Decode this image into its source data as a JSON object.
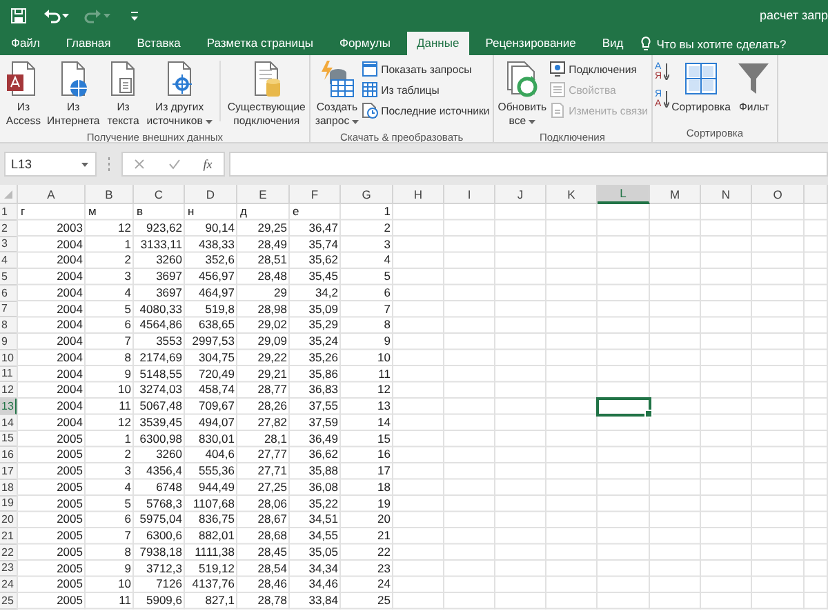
{
  "window": {
    "title": "расчет запр"
  },
  "quick_access": [
    {
      "kind": "save",
      "disabled": false
    },
    {
      "kind": "undo",
      "disabled": false
    },
    {
      "kind": "redo",
      "disabled": true
    },
    {
      "kind": "customize",
      "disabled": false
    }
  ],
  "tabs": [
    {
      "label": "Файл",
      "selected": false
    },
    {
      "label": "Главная",
      "selected": false
    },
    {
      "label": "Вставка",
      "selected": false
    },
    {
      "label": "Разметка страницы",
      "selected": false
    },
    {
      "label": "Формулы",
      "selected": false
    },
    {
      "label": "Данные",
      "selected": true
    },
    {
      "label": "Рецензирование",
      "selected": false
    },
    {
      "label": "Вид",
      "selected": false
    }
  ],
  "tell_me": {
    "text": "Что вы хотите сделать?"
  },
  "ribbon": {
    "groups": [
      {
        "label": "Получение внешних данных",
        "items": [
          {
            "kind": "large",
            "lines": [
              "Из",
              "Access"
            ]
          },
          {
            "kind": "large",
            "lines": [
              "Из",
              "Интернета"
            ]
          },
          {
            "kind": "large",
            "lines": [
              "Из",
              "текста"
            ]
          },
          {
            "kind": "large",
            "lines": [
              "Из других",
              "источников"
            ],
            "dropdown": true
          },
          {
            "kind": "separator"
          },
          {
            "kind": "large",
            "lines": [
              "Существующие",
              "подключения"
            ]
          }
        ]
      },
      {
        "label": "Скачать & преобразовать",
        "items": [
          {
            "kind": "large",
            "lines": [
              "Создать",
              "запрос"
            ],
            "dropdown": true
          },
          {
            "kind": "stack",
            "entries": [
              {
                "label": "Показать запросы",
                "disabled": false
              },
              {
                "label": "Из таблицы",
                "disabled": false
              },
              {
                "label": "Последние источники",
                "disabled": false
              }
            ]
          }
        ]
      },
      {
        "label": "Подключения",
        "items": [
          {
            "kind": "large",
            "lines": [
              "Обновить",
              "все"
            ],
            "dropdown": true
          },
          {
            "kind": "stack",
            "entries": [
              {
                "label": "Подключения",
                "disabled": false
              },
              {
                "label": "Свойства",
                "disabled": true
              },
              {
                "label": "Изменить связи",
                "disabled": true
              }
            ]
          }
        ]
      },
      {
        "label": "Сортировка",
        "items": [
          {
            "kind": "sort-stack",
            "entries": [
              {
                "top": "А",
                "bottom": "Я"
              },
              {
                "top": "Я",
                "bottom": "А"
              }
            ]
          },
          {
            "kind": "large",
            "lines": [
              "Сортировка"
            ]
          },
          {
            "kind": "large",
            "lines": [
              "Фильт"
            ]
          }
        ]
      }
    ]
  },
  "name_box": {
    "value": "L13"
  },
  "formula_bar": {
    "function_label": "fx"
  },
  "columns": [
    {
      "label": "A",
      "selected": false
    },
    {
      "label": "B",
      "selected": false
    },
    {
      "label": "C",
      "selected": false
    },
    {
      "label": "D",
      "selected": false
    },
    {
      "label": "E",
      "selected": false
    },
    {
      "label": "F",
      "selected": false
    },
    {
      "label": "G",
      "selected": false
    },
    {
      "label": "H",
      "selected": false
    },
    {
      "label": "I",
      "selected": false
    },
    {
      "label": "J",
      "selected": false
    },
    {
      "label": "K",
      "selected": false
    },
    {
      "label": "L",
      "selected": true
    },
    {
      "label": "M",
      "selected": false
    },
    {
      "label": "N",
      "selected": false
    },
    {
      "label": "O",
      "selected": false
    }
  ],
  "rows": [
    {
      "number": "1",
      "selected": false,
      "cells": [
        {
          "kind": "text",
          "value": "г"
        },
        {
          "kind": "text",
          "value": "м"
        },
        {
          "kind": "text",
          "value": "в"
        },
        {
          "kind": "text",
          "value": "н"
        },
        {
          "kind": "text",
          "value": "д"
        },
        {
          "kind": "text",
          "value": "е"
        },
        {
          "kind": "number",
          "value": "1"
        }
      ]
    },
    {
      "number": "2",
      "selected": false,
      "cells": [
        "2003",
        "12",
        "923,62",
        "90,14",
        "29,25",
        "36,47",
        "2"
      ]
    },
    {
      "number": "3",
      "selected": false,
      "cells": [
        "2004",
        "1",
        "3133,11",
        "438,33",
        "28,49",
        "35,74",
        "3"
      ]
    },
    {
      "number": "4",
      "selected": false,
      "cells": [
        "2004",
        "2",
        "3260",
        "352,6",
        "28,51",
        "35,62",
        "4"
      ]
    },
    {
      "number": "5",
      "selected": false,
      "cells": [
        "2004",
        "3",
        "3697",
        "456,97",
        "28,48",
        "35,45",
        "5"
      ]
    },
    {
      "number": "6",
      "selected": false,
      "cells": [
        "2004",
        "4",
        "3697",
        "464,97",
        "29",
        "34,2",
        "6"
      ]
    },
    {
      "number": "7",
      "selected": false,
      "cells": [
        "2004",
        "5",
        "4080,33",
        "519,8",
        "28,98",
        "35,09",
        "7"
      ]
    },
    {
      "number": "8",
      "selected": false,
      "cells": [
        "2004",
        "6",
        "4564,86",
        "638,65",
        "29,02",
        "35,29",
        "8"
      ]
    },
    {
      "number": "9",
      "selected": false,
      "cells": [
        "2004",
        "7",
        "3553",
        "2997,53",
        "29,09",
        "35,24",
        "9"
      ]
    },
    {
      "number": "10",
      "selected": false,
      "cells": [
        "2004",
        "8",
        "2174,69",
        "304,75",
        "29,22",
        "35,26",
        "10"
      ]
    },
    {
      "number": "11",
      "selected": false,
      "cells": [
        "2004",
        "9",
        "5148,55",
        "720,49",
        "29,21",
        "35,86",
        "11"
      ]
    },
    {
      "number": "12",
      "selected": false,
      "cells": [
        "2004",
        "10",
        "3274,03",
        "458,74",
        "28,77",
        "36,83",
        "12"
      ]
    },
    {
      "number": "13",
      "selected": true,
      "cells": [
        "2004",
        "11",
        "5067,48",
        "709,67",
        "28,26",
        "37,55",
        "13"
      ]
    },
    {
      "number": "14",
      "selected": false,
      "cells": [
        "2004",
        "12",
        "3539,45",
        "494,07",
        "27,82",
        "37,59",
        "14"
      ]
    },
    {
      "number": "15",
      "selected": false,
      "cells": [
        "2005",
        "1",
        "6300,98",
        "830,01",
        "28,1",
        "36,49",
        "15"
      ]
    },
    {
      "number": "16",
      "selected": false,
      "cells": [
        "2005",
        "2",
        "3260",
        "404,6",
        "27,77",
        "36,62",
        "16"
      ]
    },
    {
      "number": "17",
      "selected": false,
      "cells": [
        "2005",
        "3",
        "4356,4",
        "555,36",
        "27,71",
        "35,88",
        "17"
      ]
    },
    {
      "number": "18",
      "selected": false,
      "cells": [
        "2005",
        "4",
        "6748",
        "944,49",
        "27,25",
        "36,08",
        "18"
      ]
    },
    {
      "number": "19",
      "selected": false,
      "cells": [
        "2005",
        "5",
        "5768,3",
        "1107,68",
        "28,06",
        "35,22",
        "19"
      ]
    },
    {
      "number": "20",
      "selected": false,
      "cells": [
        "2005",
        "6",
        "5975,04",
        "836,75",
        "28,67",
        "34,51",
        "20"
      ]
    },
    {
      "number": "21",
      "selected": false,
      "cells": [
        "2005",
        "7",
        "6300,6",
        "882,01",
        "28,68",
        "34,55",
        "21"
      ]
    },
    {
      "number": "22",
      "selected": false,
      "cells": [
        "2005",
        "8",
        "7938,18",
        "1111,38",
        "28,45",
        "35,05",
        "22"
      ]
    },
    {
      "number": "23",
      "selected": false,
      "cells": [
        "2005",
        "9",
        "3712,3",
        "519,12",
        "28,54",
        "34,34",
        "23"
      ]
    },
    {
      "number": "24",
      "selected": false,
      "cells": [
        "2005",
        "10",
        "7126",
        "4137,76",
        "28,46",
        "34,46",
        "24"
      ]
    },
    {
      "number": "25",
      "selected": false,
      "cells": [
        "2005",
        "11",
        "5909,6",
        "827,1",
        "28,78",
        "33,84",
        "25"
      ]
    }
  ]
}
